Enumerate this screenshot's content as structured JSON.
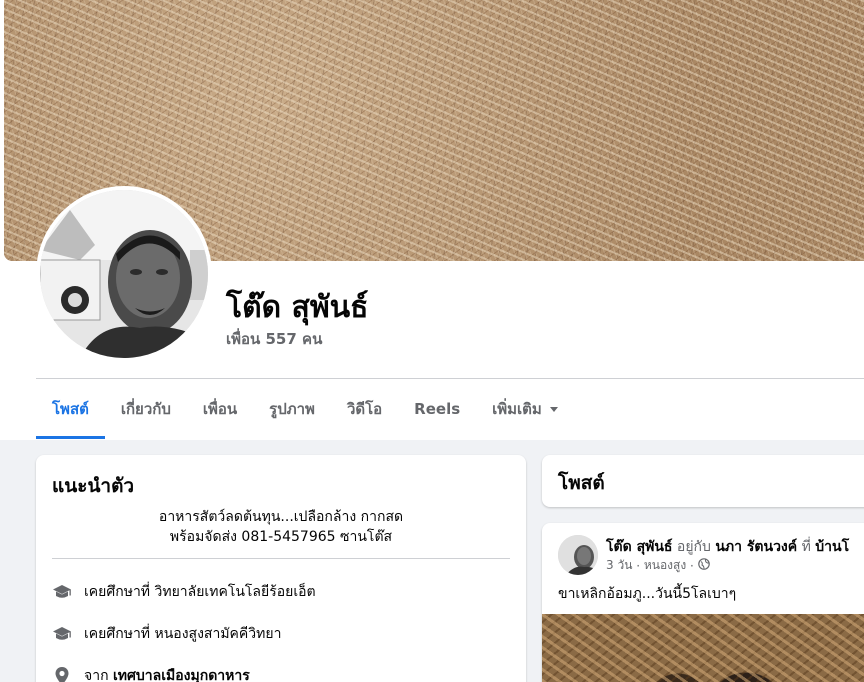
{
  "profile": {
    "name": "โต๊ด สุพันธ์",
    "friends": "เพื่อน 557 คน"
  },
  "tabs": [
    {
      "label": "โพสต์",
      "active": true
    },
    {
      "label": "เกี่ยวกับ"
    },
    {
      "label": "เพื่อน"
    },
    {
      "label": "รูปภาพ"
    },
    {
      "label": "วิดีโอ"
    },
    {
      "label": "Reels"
    },
    {
      "label": "เพิ่มเติม"
    }
  ],
  "intro": {
    "title": "แนะนำตัว",
    "bio_line1": "อาหารสัตว์ลดต้นทุน...เปลือกล้าง กากสด",
    "bio_line2": "พร้อมจัดส่ง 081-5457965 ซานโต๊ส",
    "items": [
      {
        "icon": "graduation-cap-icon",
        "prefix": "เคยศึกษาที่",
        "value": "วิทยาลัยเทคโนโลยีร้อยเอ็ต"
      },
      {
        "icon": "graduation-cap-icon",
        "prefix": "เคยศึกษาที่",
        "value": "หนองสูงสามัคคีวิทยา"
      },
      {
        "icon": "location-pin-icon",
        "prefix": "จาก",
        "value": "เทศบาลเมืองมุกดาหาร"
      }
    ]
  },
  "posts_section": {
    "title": "โพสต์"
  },
  "post": {
    "author": "โต๊ด สุพันธ์",
    "with_text": "อยู่กับ",
    "tagged": "นภา รัตนวงค์",
    "at_text": "ที่",
    "place": "บ้านโ",
    "time": "3 วัน",
    "location": "หนองสูง",
    "privacy_icon": "globe-icon",
    "text": "ขาเหลิกอ้อมภู...วันนี้5โลเบาๆ"
  },
  "colors": {
    "accent": "#1b74e4",
    "secondary_text": "#65676b",
    "background": "#f0f2f5"
  }
}
